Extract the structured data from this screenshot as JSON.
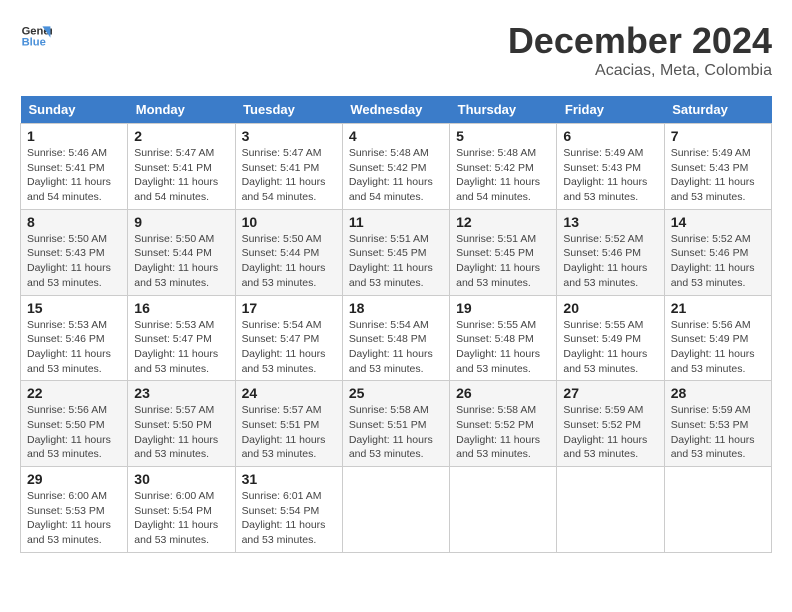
{
  "logo": {
    "line1": "General",
    "line2": "Blue"
  },
  "header": {
    "month": "December 2024",
    "location": "Acacias, Meta, Colombia"
  },
  "days_of_week": [
    "Sunday",
    "Monday",
    "Tuesday",
    "Wednesday",
    "Thursday",
    "Friday",
    "Saturday"
  ],
  "weeks": [
    [
      {
        "day": "1",
        "info": "Sunrise: 5:46 AM\nSunset: 5:41 PM\nDaylight: 11 hours\nand 54 minutes."
      },
      {
        "day": "2",
        "info": "Sunrise: 5:47 AM\nSunset: 5:41 PM\nDaylight: 11 hours\nand 54 minutes."
      },
      {
        "day": "3",
        "info": "Sunrise: 5:47 AM\nSunset: 5:41 PM\nDaylight: 11 hours\nand 54 minutes."
      },
      {
        "day": "4",
        "info": "Sunrise: 5:48 AM\nSunset: 5:42 PM\nDaylight: 11 hours\nand 54 minutes."
      },
      {
        "day": "5",
        "info": "Sunrise: 5:48 AM\nSunset: 5:42 PM\nDaylight: 11 hours\nand 54 minutes."
      },
      {
        "day": "6",
        "info": "Sunrise: 5:49 AM\nSunset: 5:43 PM\nDaylight: 11 hours\nand 53 minutes."
      },
      {
        "day": "7",
        "info": "Sunrise: 5:49 AM\nSunset: 5:43 PM\nDaylight: 11 hours\nand 53 minutes."
      }
    ],
    [
      {
        "day": "8",
        "info": "Sunrise: 5:50 AM\nSunset: 5:43 PM\nDaylight: 11 hours\nand 53 minutes."
      },
      {
        "day": "9",
        "info": "Sunrise: 5:50 AM\nSunset: 5:44 PM\nDaylight: 11 hours\nand 53 minutes."
      },
      {
        "day": "10",
        "info": "Sunrise: 5:50 AM\nSunset: 5:44 PM\nDaylight: 11 hours\nand 53 minutes."
      },
      {
        "day": "11",
        "info": "Sunrise: 5:51 AM\nSunset: 5:45 PM\nDaylight: 11 hours\nand 53 minutes."
      },
      {
        "day": "12",
        "info": "Sunrise: 5:51 AM\nSunset: 5:45 PM\nDaylight: 11 hours\nand 53 minutes."
      },
      {
        "day": "13",
        "info": "Sunrise: 5:52 AM\nSunset: 5:46 PM\nDaylight: 11 hours\nand 53 minutes."
      },
      {
        "day": "14",
        "info": "Sunrise: 5:52 AM\nSunset: 5:46 PM\nDaylight: 11 hours\nand 53 minutes."
      }
    ],
    [
      {
        "day": "15",
        "info": "Sunrise: 5:53 AM\nSunset: 5:46 PM\nDaylight: 11 hours\nand 53 minutes."
      },
      {
        "day": "16",
        "info": "Sunrise: 5:53 AM\nSunset: 5:47 PM\nDaylight: 11 hours\nand 53 minutes."
      },
      {
        "day": "17",
        "info": "Sunrise: 5:54 AM\nSunset: 5:47 PM\nDaylight: 11 hours\nand 53 minutes."
      },
      {
        "day": "18",
        "info": "Sunrise: 5:54 AM\nSunset: 5:48 PM\nDaylight: 11 hours\nand 53 minutes."
      },
      {
        "day": "19",
        "info": "Sunrise: 5:55 AM\nSunset: 5:48 PM\nDaylight: 11 hours\nand 53 minutes."
      },
      {
        "day": "20",
        "info": "Sunrise: 5:55 AM\nSunset: 5:49 PM\nDaylight: 11 hours\nand 53 minutes."
      },
      {
        "day": "21",
        "info": "Sunrise: 5:56 AM\nSunset: 5:49 PM\nDaylight: 11 hours\nand 53 minutes."
      }
    ],
    [
      {
        "day": "22",
        "info": "Sunrise: 5:56 AM\nSunset: 5:50 PM\nDaylight: 11 hours\nand 53 minutes."
      },
      {
        "day": "23",
        "info": "Sunrise: 5:57 AM\nSunset: 5:50 PM\nDaylight: 11 hours\nand 53 minutes."
      },
      {
        "day": "24",
        "info": "Sunrise: 5:57 AM\nSunset: 5:51 PM\nDaylight: 11 hours\nand 53 minutes."
      },
      {
        "day": "25",
        "info": "Sunrise: 5:58 AM\nSunset: 5:51 PM\nDaylight: 11 hours\nand 53 minutes."
      },
      {
        "day": "26",
        "info": "Sunrise: 5:58 AM\nSunset: 5:52 PM\nDaylight: 11 hours\nand 53 minutes."
      },
      {
        "day": "27",
        "info": "Sunrise: 5:59 AM\nSunset: 5:52 PM\nDaylight: 11 hours\nand 53 minutes."
      },
      {
        "day": "28",
        "info": "Sunrise: 5:59 AM\nSunset: 5:53 PM\nDaylight: 11 hours\nand 53 minutes."
      }
    ],
    [
      {
        "day": "29",
        "info": "Sunrise: 6:00 AM\nSunset: 5:53 PM\nDaylight: 11 hours\nand 53 minutes."
      },
      {
        "day": "30",
        "info": "Sunrise: 6:00 AM\nSunset: 5:54 PM\nDaylight: 11 hours\nand 53 minutes."
      },
      {
        "day": "31",
        "info": "Sunrise: 6:01 AM\nSunset: 5:54 PM\nDaylight: 11 hours\nand 53 minutes."
      },
      {
        "day": "",
        "info": ""
      },
      {
        "day": "",
        "info": ""
      },
      {
        "day": "",
        "info": ""
      },
      {
        "day": "",
        "info": ""
      }
    ]
  ]
}
